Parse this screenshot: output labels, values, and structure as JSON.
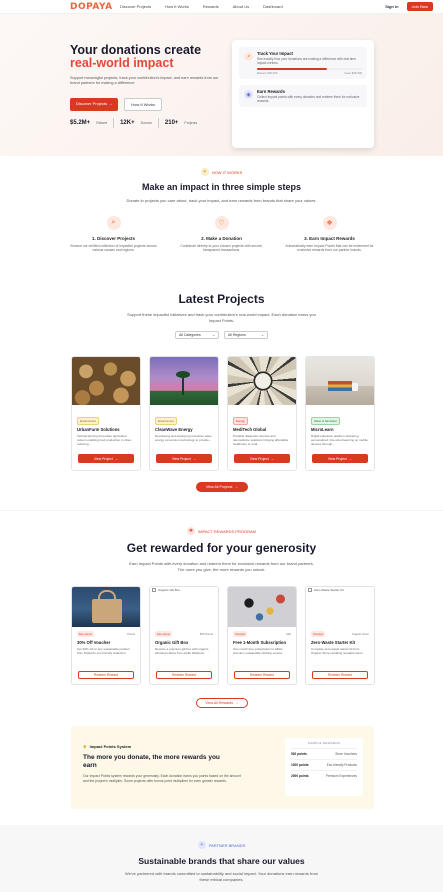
{
  "header": {
    "logo": "DOPAYA",
    "nav": [
      "Discover Projects",
      "How It Works",
      "Rewards",
      "About Us",
      "Dashboard"
    ],
    "signin": "Sign In",
    "join": "Join Now"
  },
  "hero": {
    "title_line1": "Your donations create",
    "title_line2": "real-world impact",
    "description": "Support meaningful projects, track your contribution's impact, and earn rewards from our brand partners for making a difference.",
    "primary_btn": "Discover Projects",
    "secondary_btn": "How It Works",
    "stats": [
      {
        "value": "$5.2M+",
        "label": "Raised"
      },
      {
        "value": "12K+",
        "label": "Donors"
      },
      {
        "value": "210+",
        "label": "Projects"
      }
    ],
    "card": {
      "track_title": "Track Your Impact",
      "track_desc": "See exactly how your donations are making a difference with real-time impact metrics.",
      "raised_label": "Raised: $30,000",
      "goal_label": "Goal: $45,000",
      "progress": 0.67,
      "earn_title": "Earn Rewards",
      "earn_desc": "Collect Impact points with every donation and redeem them for exclusive rewards."
    }
  },
  "how": {
    "badge": "HOW IT WORKS",
    "title": "Make an impact in three simple steps",
    "subtitle": "Donate to projects you care about, track your impact, and earn rewards from brands that share your values.",
    "steps": [
      {
        "title": "1. Discover Projects",
        "desc": "Browse our verified collection of impactful projects across various causes and regions."
      },
      {
        "title": "2. Make a Donation",
        "desc": "Contribute directly to your chosen projects with secure, transparent transactions."
      },
      {
        "title": "3. Earn Impact Rewards",
        "desc": "Automatically earn Impact Points that can be redeemed for exclusive rewards from our partner brands."
      }
    ]
  },
  "projects": {
    "title": "Latest Projects",
    "subtitle": "Support these impactful initiatives and track your contribution's real-world impact. Each donation earns you Impact Points.",
    "filter_categories": "All Categories",
    "filter_regions": "All Regions",
    "items": [
      {
        "tag": "Environment",
        "title": "UrbanFarm Solutions",
        "desc": "Vertical farming and urban agriculture system enabling food production in cities, reducing...",
        "btn": "View Project"
      },
      {
        "tag": "Environment",
        "title": "CleanWave Energy",
        "desc": "Developing and deploying innovative wave energy conversion technology to provide...",
        "btn": "View Project"
      },
      {
        "tag": "Energy",
        "title": "MediTech Global",
        "desc": "Portable diagnostic devices and telemedicine solutions bringing affordable healthcare to rural...",
        "btn": "View Project"
      },
      {
        "tag": "Water & Sanitation",
        "title": "MicroLearn",
        "desc": "Digital education platform delivering personalized, bite-sized learning on mobile devices through...",
        "btn": "View Project"
      }
    ],
    "view_all": "View All Projects"
  },
  "rewards": {
    "badge": "IMPACT REWARDS PROGRAM",
    "title": "Get rewarded for your generosity",
    "subtitle": "Earn Impact Points with every donation and redeem them for exclusive rewards from our brand partners. The more you give, the more rewards you unlock.",
    "items": [
      {
        "tag": "Eco Home",
        "cost": "Points",
        "title": "30% Off Voucher",
        "desc": "Get 30% off on any sustainable product from Flipkart's eco-friendly collection.",
        "btn": "Redeem Reward",
        "alt": ""
      },
      {
        "tag": "Eco Home",
        "cost": "800 Points",
        "title": "Organic Gift Box",
        "desc": "Receive a premium gift box with organic, ethical products from ethkh Wellness.",
        "btn": "Redeem Reward",
        "alt": "Organic Gift Box"
      },
      {
        "tag": "Lifestyle",
        "cost": "Alfa",
        "title": "Free 1-Month Subscription",
        "desc": "One month free subscription to Alfia's premium sustainable clothing service.",
        "btn": "Redeem Reward",
        "alt": ""
      },
      {
        "tag": "Lifestyle",
        "cost": "Organic Store",
        "title": "Zero-Waste Starter Kit",
        "desc": "Complete zero-waste starter kit from Organic Store including reusable items.",
        "btn": "Redeem Reward",
        "alt": "Zero-Waste Starter Kit"
      }
    ],
    "view_all": "View All Rewards",
    "impact": {
      "label": "Impact Points System",
      "heading": "The more you donate, the more rewards you earn",
      "desc": "Our Impact Points system rewards your generosity. Each donation earns you points based on the amount and the project's multiplier. Some projects offer bonus point multipliers for even greater rewards.",
      "card_header": "SAMPLE REWARDS",
      "rows": [
        {
          "points": "500 points",
          "reward": "Store Vouchers"
        },
        {
          "points": "1000 points",
          "reward": "Eco-friendly Products"
        },
        {
          "points": "2000 points",
          "reward": "Premium Experiences"
        }
      ]
    }
  },
  "brands": {
    "badge": "PARTNER BRANDS",
    "title": "Sustainable brands that share our values",
    "subtitle": "We've partnered with brands committed to sustainability and social impact. Your donations earn rewards from these ethical companies."
  },
  "colors": {
    "accent": "#d93a1f",
    "brand": "#e8653a"
  }
}
